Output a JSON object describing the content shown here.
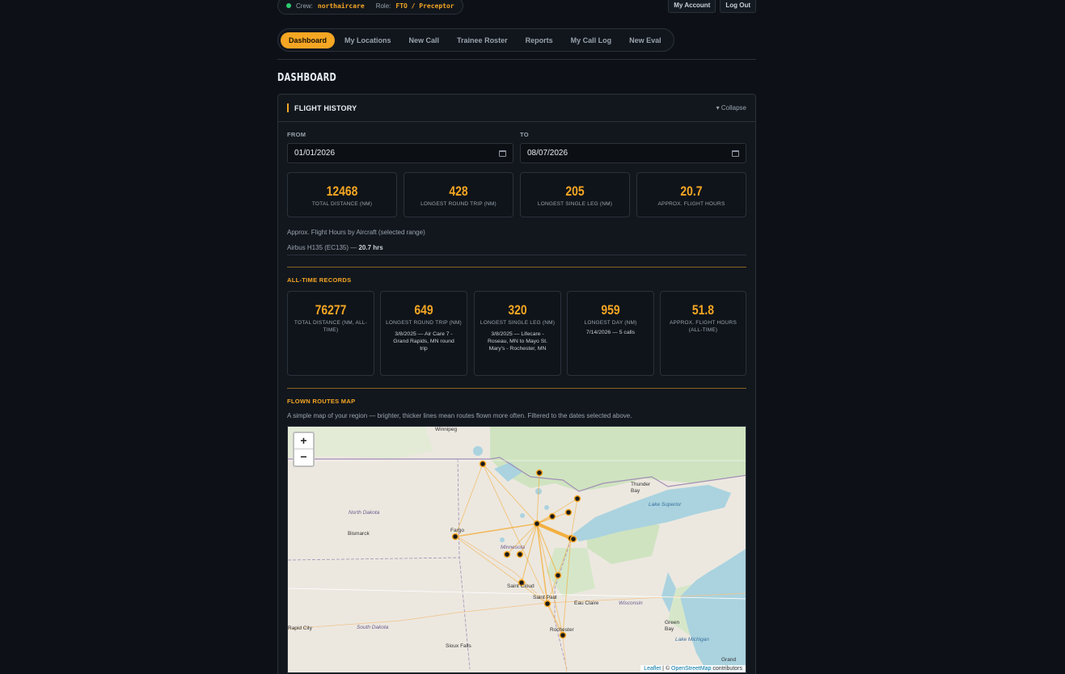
{
  "header": {
    "crew_label": "Crew:",
    "crew_value": "northaircare",
    "role_label": "Role:",
    "role_value": "FTO / Preceptor",
    "my_account": "My Account",
    "log_out": "Log Out"
  },
  "nav": {
    "tabs": [
      "Dashboard",
      "My Locations",
      "New Call",
      "Trainee Roster",
      "Reports",
      "My Call Log",
      "New Eval"
    ],
    "active": "Dashboard"
  },
  "page_title": "DASHBOARD",
  "flight_history": {
    "title": "FLIGHT HISTORY",
    "collapse": "▾ Collapse",
    "from_label": "FROM",
    "from_value": "01/01/2026",
    "to_label": "TO",
    "to_value": "08/07/2026",
    "stats": [
      {
        "value": "12468",
        "caption": "TOTAL DISTANCE (NM)"
      },
      {
        "value": "428",
        "caption": "LONGEST ROUND TRIP (NM)"
      },
      {
        "value": "205",
        "caption": "LONGEST SINGLE LEG (NM)"
      },
      {
        "value": "20.7",
        "caption": "APPROX. FLIGHT HOURS"
      }
    ],
    "hours_by_aircraft_label": "Approx. Flight Hours by Aircraft (selected range)",
    "aircraft_line_prefix": "Airbus H135 (EC135) — ",
    "aircraft_line_hours": "20.7 hrs"
  },
  "all_time": {
    "title": "ALL-TIME RECORDS",
    "records": [
      {
        "value": "76277",
        "caption": "TOTAL DISTANCE (NM, ALL-TIME)",
        "sub": ""
      },
      {
        "value": "649",
        "caption": "LONGEST ROUND TRIP (NM)",
        "sub": "3/8/2025 — Air Care 7 - Grand Rapids, MN round trip"
      },
      {
        "value": "320",
        "caption": "LONGEST SINGLE LEG (NM)",
        "sub": "3/8/2025 — Lifecare - Roseau, MN to Mayo St. Mary's - Rochester, MN"
      },
      {
        "value": "959",
        "caption": "LONGEST DAY (NM)",
        "sub": "7/14/2026 — 5 calls"
      },
      {
        "value": "51.8",
        "caption": "APPROX. FLIGHT HOURS (ALL-TIME)",
        "sub": ""
      }
    ]
  },
  "map_section": {
    "title": "FLOWN ROUTES MAP",
    "description": "A simple map of your region — brighter, thicker lines mean routes flown more often. Filtered to the dates selected above.",
    "zoom_in": "+",
    "zoom_out": "−",
    "attrib_leaflet": "Leaflet",
    "attrib_sep": " | © ",
    "attrib_osm": "OpenStreetMap",
    "attrib_tail": " contributors",
    "place_labels": [
      "Winnipeg",
      "North Dakota",
      "Bismarck",
      "Fargo",
      "Minnesota",
      "Saint Cloud",
      "Saint Paul",
      "Eau Claire",
      "Wisconsin",
      "Rochester",
      "Sioux Falls",
      "South Dakota",
      "Rapid City",
      "Thunder Bay",
      "Lake Superior",
      "Green Bay",
      "Lake Michigan",
      "Grand"
    ]
  },
  "colors": {
    "accent": "#f5a623",
    "background": "#0d1117",
    "card": "#12171e",
    "status_online": "#2ecc71"
  }
}
